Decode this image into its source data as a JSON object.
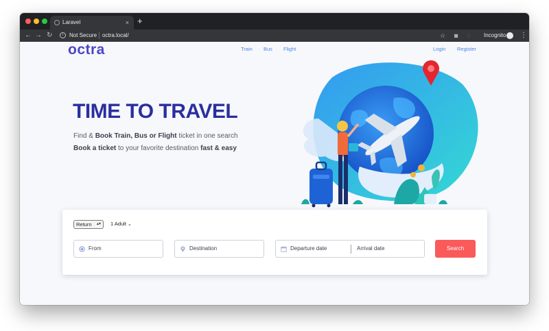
{
  "browser": {
    "tab_title": "Laravel",
    "tab_close": "×",
    "new_tab": "+",
    "security_label": "Not Secure",
    "url": "octra.local/",
    "incognito_label": "Incognito",
    "icons": [
      "back-icon",
      "forward-icon",
      "reload-icon",
      "info-icon",
      "star-icon",
      "camera-icon",
      "extension-icon",
      "incognito-icon",
      "menu-icon"
    ]
  },
  "header": {
    "logo": "octra",
    "nav": [
      "Train",
      "Bus",
      "Flight"
    ],
    "login": "Login",
    "register": "Register"
  },
  "hero": {
    "title": "TIME TO TRAVEL",
    "line1_prefix": "Find & ",
    "line1_bold": "Book Train, Bus or Flight",
    "line1_suffix": " ticket in one search",
    "line2_bold_start": "Book a ticket",
    "line2_middle": " to your favorite destination ",
    "line2_bold_end": "fast & easy"
  },
  "search": {
    "trip_type": "Return",
    "passengers": "1 Adult",
    "from_placeholder": "From",
    "destination_placeholder": "Destination",
    "departure_placeholder": "Departure date",
    "arrival_placeholder": "Arrival date",
    "search_button": "Search"
  },
  "colors": {
    "brand": "#4b46c6",
    "title": "#2a2f9e",
    "link": "#4a86e8",
    "search_button": "#fa5a5a"
  }
}
